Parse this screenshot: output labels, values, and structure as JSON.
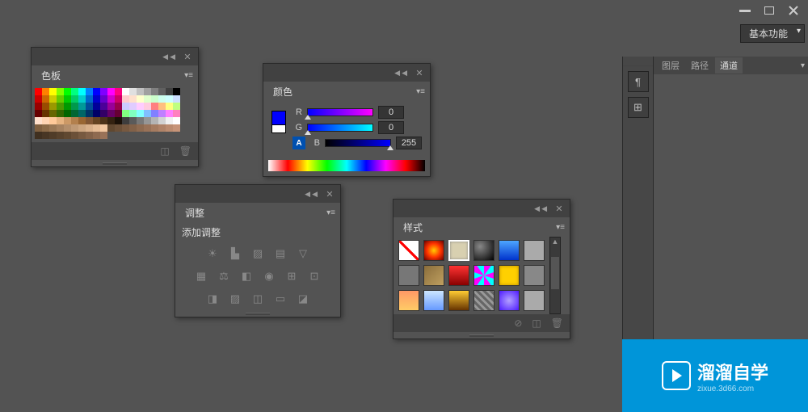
{
  "workspace_label": "基本功能",
  "panels": {
    "swatches": {
      "title": "色板",
      "colors": [
        "#ff0000",
        "#ff8000",
        "#ffff00",
        "#80ff00",
        "#00ff00",
        "#00ff80",
        "#00ffff",
        "#0080ff",
        "#0000ff",
        "#8000ff",
        "#ff00ff",
        "#ff0080",
        "#ffffff",
        "#e0e0e0",
        "#c0c0c0",
        "#a0a0a0",
        "#808080",
        "#606060",
        "#404040",
        "#000000",
        "#cc0000",
        "#cc6600",
        "#cccc00",
        "#66cc00",
        "#00cc00",
        "#00cc66",
        "#00cccc",
        "#0066cc",
        "#0000cc",
        "#6600cc",
        "#cc00cc",
        "#cc0066",
        "#ffcccc",
        "#ffe0cc",
        "#ffffcc",
        "#e0ffcc",
        "#ccffcc",
        "#ccffee",
        "#ccffff",
        "#cce0ff",
        "#990000",
        "#994c00",
        "#999900",
        "#4c9900",
        "#009900",
        "#00994c",
        "#009999",
        "#004c99",
        "#000099",
        "#4c0099",
        "#990099",
        "#99004c",
        "#ccccff",
        "#e0ccff",
        "#ffccff",
        "#ffcce0",
        "#ff8080",
        "#ffbf80",
        "#ffff80",
        "#bfff80",
        "#660000",
        "#663300",
        "#666600",
        "#336600",
        "#006600",
        "#006633",
        "#006666",
        "#003366",
        "#000066",
        "#330066",
        "#660066",
        "#660033",
        "#80ff80",
        "#80ffbf",
        "#80ffff",
        "#80bfff",
        "#8080ff",
        "#bf80ff",
        "#ff80ff",
        "#ff80bf",
        "#ffe0cc",
        "#ffd4b3",
        "#ffc999",
        "#e6b380",
        "#cc9966",
        "#b3804d",
        "#996633",
        "#805533",
        "#664422",
        "#4d3319",
        "#332211",
        "#1a1108",
        "#3d3d3d",
        "#5a5a5a",
        "#787878",
        "#969696",
        "#b4b4b4",
        "#d2d2d2",
        "#f0f0f0",
        "#ffffff",
        "#806040",
        "#8c6b48",
        "#997755",
        "#a68260",
        "#b38e6b",
        "#bf9975",
        "#cca580",
        "#d9b08a",
        "#e6bc95",
        "#f2c7a0",
        "#604830",
        "#6b5038",
        "#775940",
        "#826148",
        "#8e6a50",
        "#997258",
        "#a57b60",
        "#b08368",
        "#bc8c70",
        "#c79478",
        "#403020",
        "#483624",
        "#503c28",
        "#58422c",
        "#604830",
        "#6b5038",
        "#775940",
        "#826148",
        "#8e6a50",
        "#997258"
      ]
    },
    "color": {
      "title": "颜色",
      "r": {
        "label": "R",
        "value": "0"
      },
      "g": {
        "label": "G",
        "value": "0"
      },
      "b": {
        "label": "B",
        "value": "255"
      }
    },
    "adjustments": {
      "title": "调整",
      "subtitle": "添加调整"
    },
    "styles": {
      "title": "样式"
    }
  },
  "dock": {
    "tab1": "图层",
    "tab2": "路径",
    "tab3": "通道"
  },
  "watermark": {
    "main": "溜溜自学",
    "sub": "zixue.3d66.com"
  }
}
